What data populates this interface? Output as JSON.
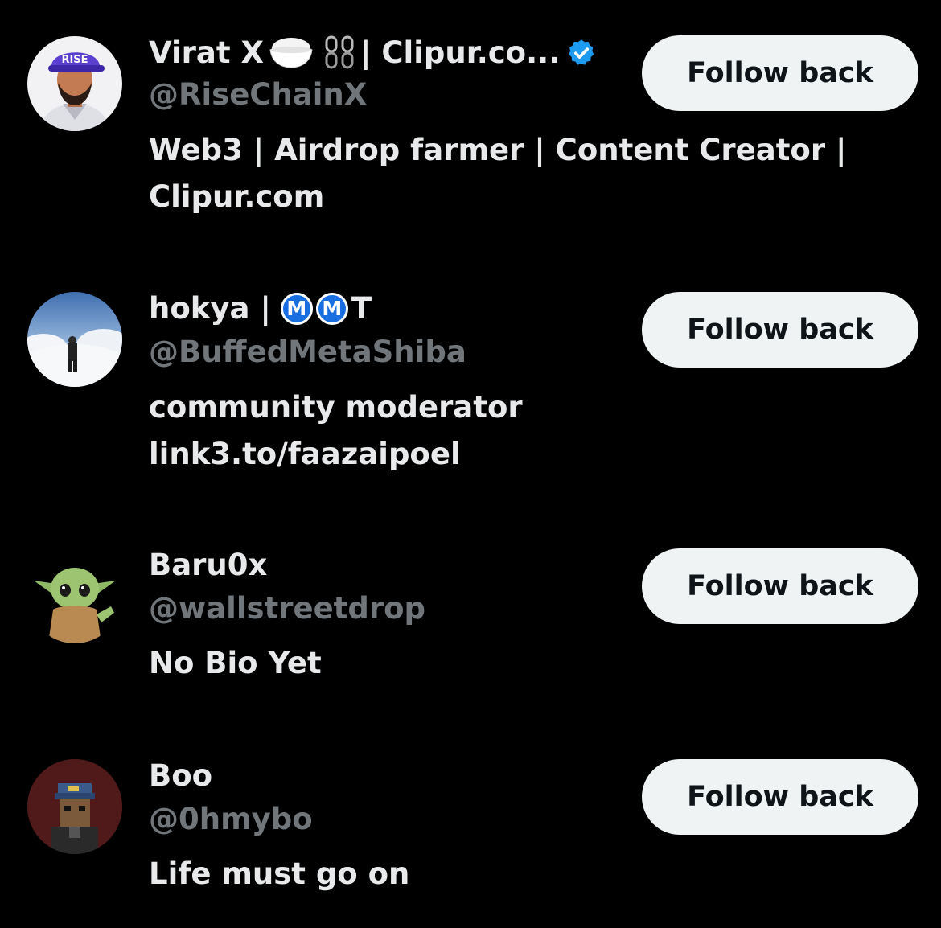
{
  "accounts": [
    {
      "name_prefix": "Virat X",
      "name_suffix": "| Clipur.co...",
      "emojis": [
        "rice-bowl-icon",
        "chain-icon"
      ],
      "verified": true,
      "handle": "@RiseChainX",
      "bio_lines": [
        "Web3 | Airdrop farmer | Content Creator |",
        "Clipur.com"
      ],
      "avatar_cap_text": "RISE",
      "button_label": "Follow back"
    },
    {
      "name_prefix": "hokya |",
      "badge_letter": "M",
      "name_suffix": "T",
      "handle": "@BuffedMetaShiba",
      "bio_lines": [
        "community moderator",
        "link3.to/faazaipoel"
      ],
      "button_label": "Follow back"
    },
    {
      "name": "Baru0x",
      "handle": "@wallstreetdrop",
      "bio_lines": [
        "No Bio Yet"
      ],
      "button_label": "Follow back"
    },
    {
      "name": "Boo",
      "handle": "@0hmybo",
      "bio_lines": [
        "Life must go on"
      ],
      "button_label": "Follow back"
    }
  ],
  "colors": {
    "background": "#000000",
    "primary_text": "#e7e9ea",
    "secondary_text": "#71767b",
    "button_bg": "#eff3f4",
    "button_text": "#0f1419",
    "verified_blue": "#1d9bf0"
  }
}
